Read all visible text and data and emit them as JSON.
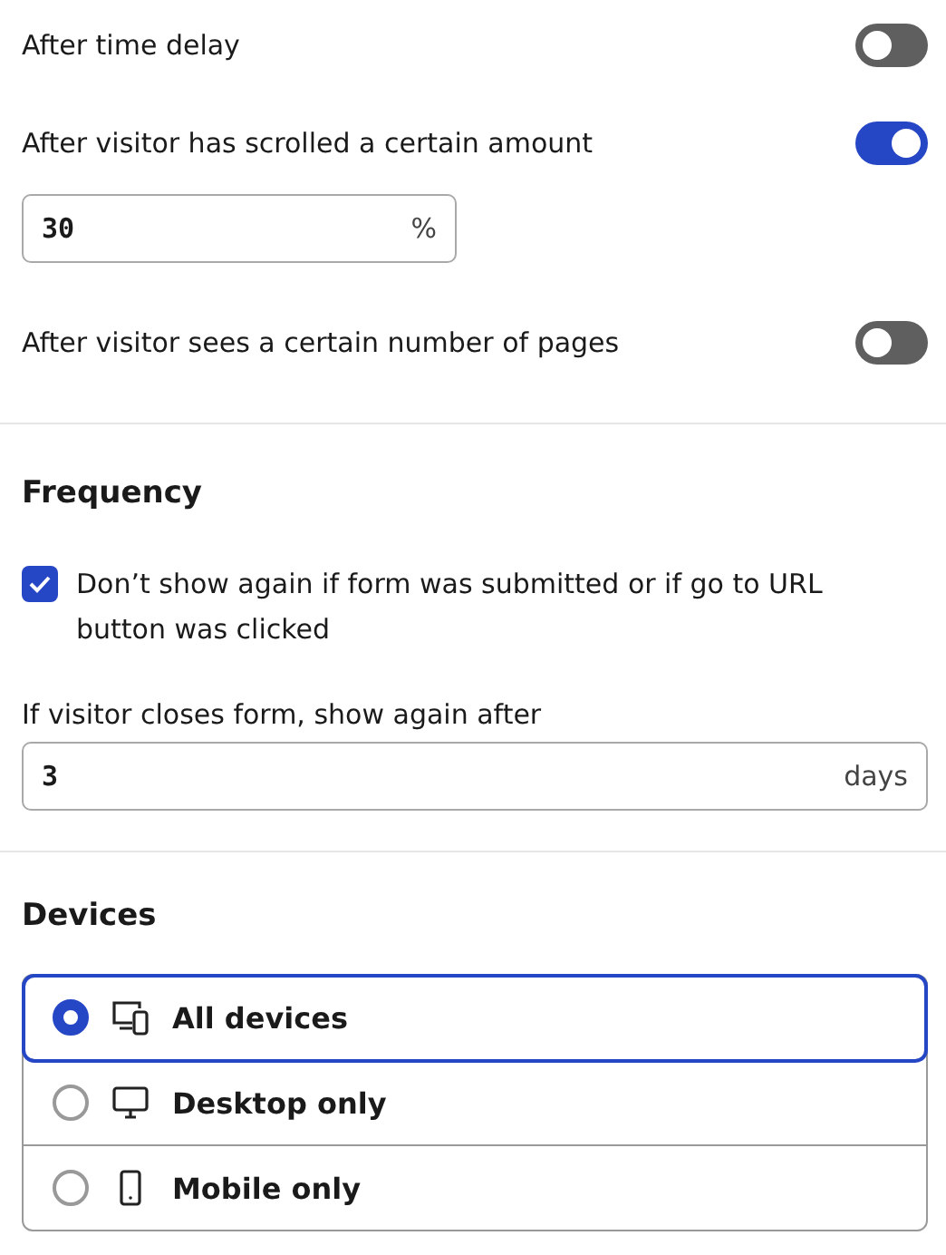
{
  "triggers": [
    {
      "kind": "toggle",
      "label": "After time delay",
      "on": false
    },
    {
      "kind": "toggle",
      "label": "After visitor has scrolled a certain amount",
      "on": true,
      "input": {
        "value": "30",
        "unit": "%"
      }
    },
    {
      "kind": "toggle",
      "label": "After visitor sees a certain number of pages",
      "on": false
    }
  ],
  "frequency": {
    "title": "Frequency",
    "checkbox": {
      "label": "Don’t show again if form was submitted or if go to URL button was clicked",
      "checked": true
    },
    "field_label": "If visitor closes form, show again after",
    "input": {
      "value": "3",
      "unit": "days"
    }
  },
  "devices": {
    "title": "Devices",
    "options": [
      {
        "kind": "all",
        "label": "All devices",
        "selected": true
      },
      {
        "kind": "desktop",
        "label": "Desktop only",
        "selected": false
      },
      {
        "kind": "mobile",
        "label": "Mobile only",
        "selected": false
      }
    ]
  }
}
